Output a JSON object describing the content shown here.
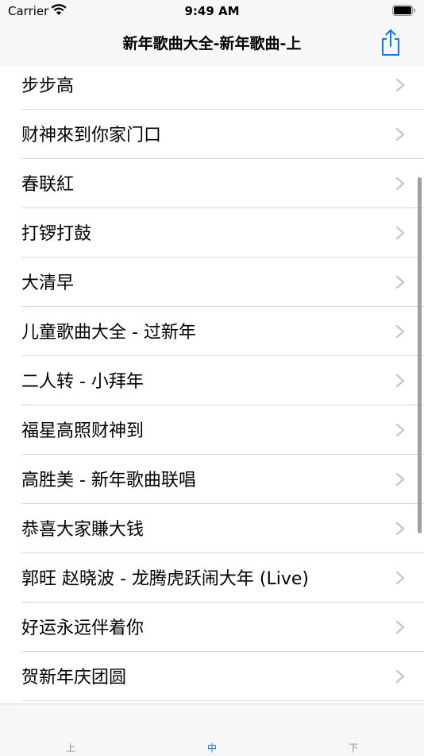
{
  "status_bar": {
    "carrier": "Carrier",
    "time": "9:49 AM"
  },
  "nav": {
    "title": "新年歌曲大全-新年歌曲-上",
    "share_icon": "share-icon"
  },
  "list": {
    "items": [
      "步步高",
      "财神來到你家门口",
      "春联紅",
      "打锣打鼓",
      "大清早",
      "儿童歌曲大全 - 过新年",
      "二人转 - 小拜年",
      "福星高照财神到",
      "高胜美 - 新年歌曲联唱",
      "恭喜大家賺大钱",
      "郭旺  赵晓波 - 龙腾虎跃闹大年 (Live)",
      "好运永远伴着你",
      "贺新年庆团圆"
    ]
  },
  "tabs": [
    {
      "label": "上",
      "selected": false
    },
    {
      "label": "中",
      "selected": true
    },
    {
      "label": "下",
      "selected": false
    }
  ],
  "colors": {
    "accent": "#007aff",
    "tab_inactive": "#8e8e93",
    "chevron": "#c4c4c7",
    "bar_background": "#f7f7f7"
  }
}
